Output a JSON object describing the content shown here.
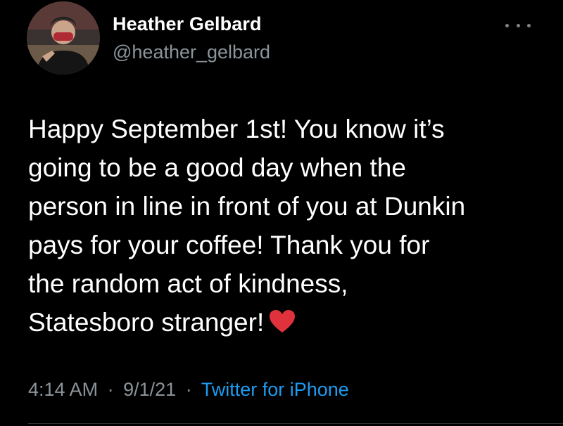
{
  "author": {
    "display_name": "Heather Gelbard",
    "handle": "@heather_gelbard",
    "avatar_icon": "profile-photo"
  },
  "tweet": {
    "lines": [
      "Happy September 1st! You know it’s",
      "going to be a good day when the",
      "person in line in front of you at Dunkin",
      "pays for your coffee! Thank you for",
      "the random act of kindness,",
      "Statesboro stranger!"
    ],
    "emoji": "red-heart-icon"
  },
  "meta": {
    "time": "4:14 AM",
    "separator": "·",
    "date": "9/1/21",
    "source": "Twitter for iPhone"
  },
  "colors": {
    "background": "#000000",
    "text": "#ffffff",
    "muted": "#8b949a",
    "link": "#1d9bf0",
    "heart": "#e0323c"
  }
}
